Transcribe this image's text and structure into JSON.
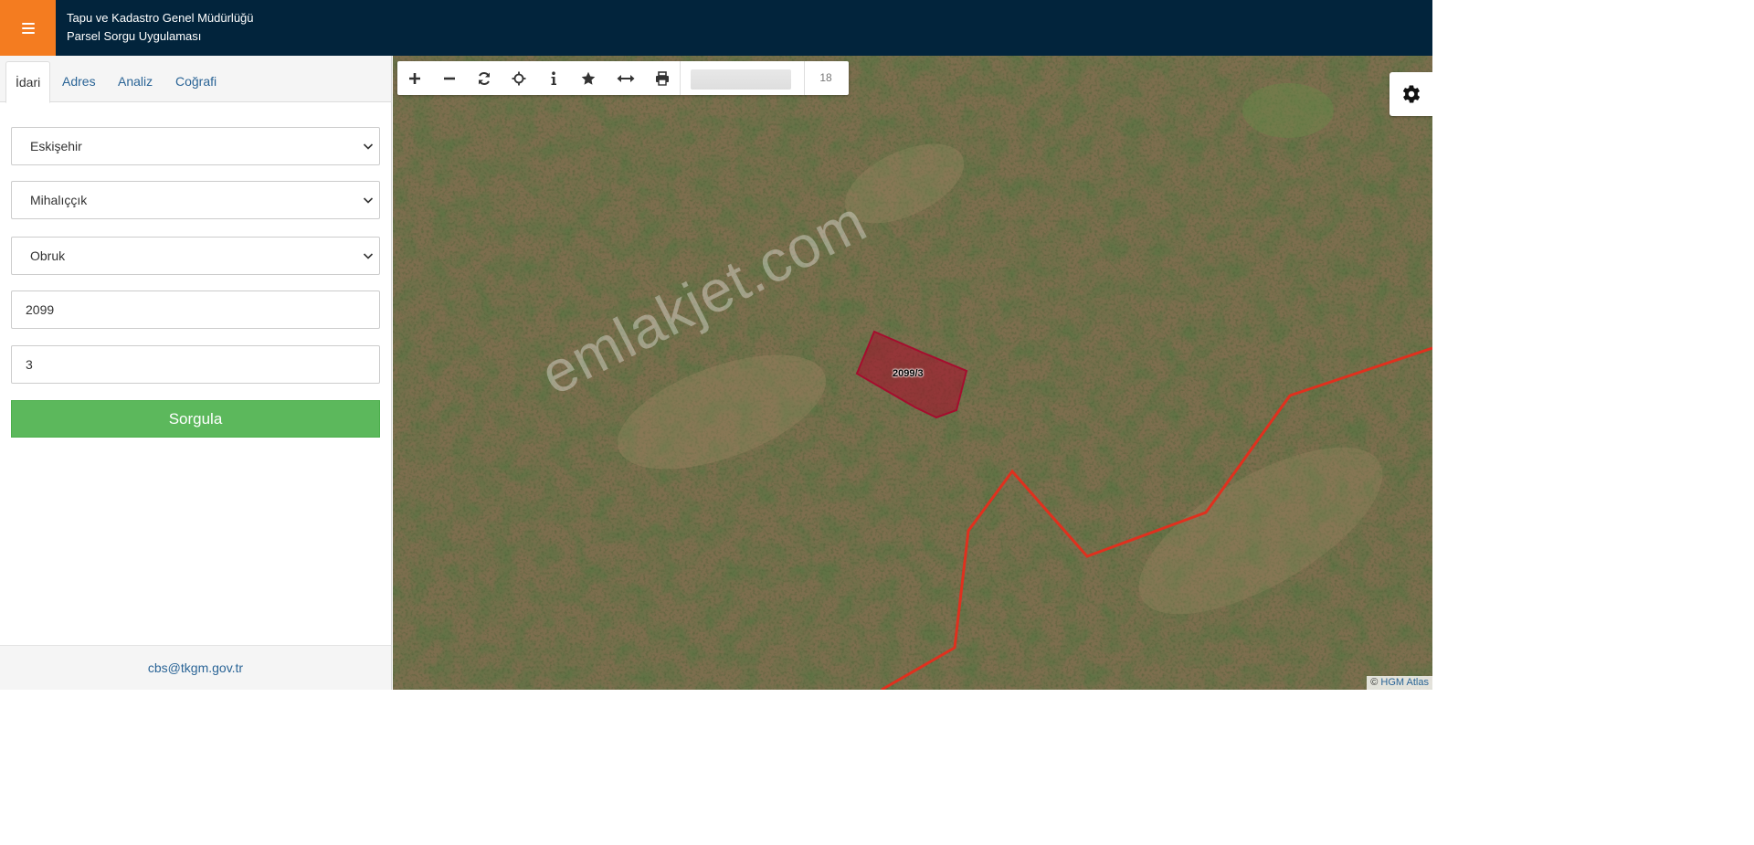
{
  "header": {
    "title_line1": "Tapu ve Kadastro Genel Müdürlüğü",
    "title_line2": "Parsel Sorgu Uygulaması",
    "menu_icon": "hamburger-icon",
    "accent_color": "#f47c20",
    "bar_color": "#02243c"
  },
  "tabs": [
    {
      "label": "İdari",
      "active": true
    },
    {
      "label": "Adres",
      "active": false
    },
    {
      "label": "Analiz",
      "active": false
    },
    {
      "label": "Coğrafi",
      "active": false
    }
  ],
  "form": {
    "il": "Eskişehir",
    "ilce": "Mihalıççık",
    "mahalle": "Obruk",
    "ada": "2099",
    "parsel": "3",
    "submit_label": "Sorgula",
    "submit_color": "#5cb85c"
  },
  "footer": {
    "email": "cbs@tkgm.gov.tr"
  },
  "map": {
    "toolbar_icons": [
      "zoom-in-icon",
      "zoom-out-icon",
      "refresh-icon",
      "locate-icon",
      "info-icon",
      "star-icon",
      "measure-icon",
      "print-icon"
    ],
    "zoom_level": "18",
    "settings_icon": "gear-icon",
    "parcel_label": "2099/3",
    "watermark": "emlakjet.com",
    "attribution_prefix": "©",
    "attribution_link": "HGM Atlas"
  }
}
